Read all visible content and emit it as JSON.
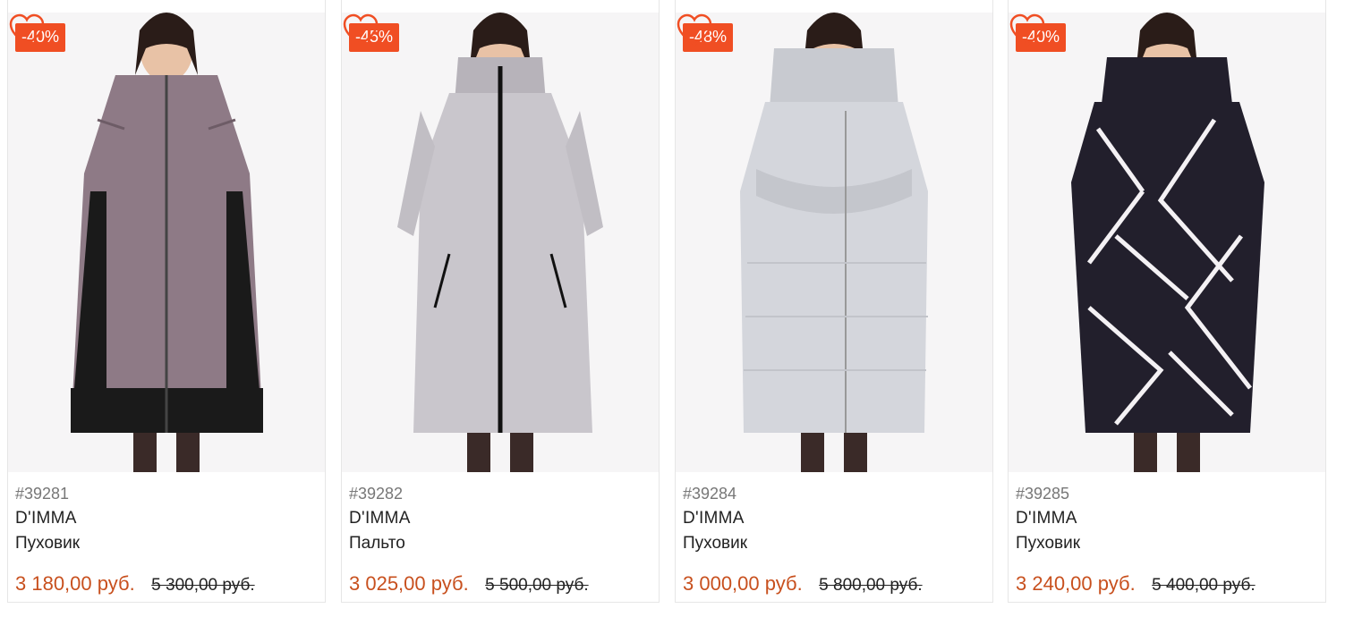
{
  "colors": {
    "badge": "#f04e23",
    "price": "#c8501e",
    "heart": "#f04e23"
  },
  "products": [
    {
      "sku": "#39281",
      "brand": "D'IMMA",
      "kind": "Пуховик",
      "discount": "-40%",
      "price": "3 180,00 руб.",
      "old_price": "5 300,00 руб.",
      "coat_color": "#8e7a86",
      "icon": "heart-icon"
    },
    {
      "sku": "#39282",
      "brand": "D'IMMA",
      "kind": "Пальто",
      "discount": "-45%",
      "price": "3 025,00 руб.",
      "old_price": "5 500,00 руб.",
      "coat_color": "#c9c6cc",
      "icon": "heart-icon"
    },
    {
      "sku": "#39284",
      "brand": "D'IMMA",
      "kind": "Пуховик",
      "discount": "-48%",
      "price": "3 000,00 руб.",
      "old_price": "5 800,00 руб.",
      "coat_color": "#d4d6dc",
      "icon": "heart-icon"
    },
    {
      "sku": "#39285",
      "brand": "D'IMMA",
      "kind": "Пуховик",
      "discount": "-40%",
      "price": "3 240,00 руб.",
      "old_price": "5 400,00 руб.",
      "coat_color": "#221f2c",
      "icon": "heart-icon"
    }
  ]
}
